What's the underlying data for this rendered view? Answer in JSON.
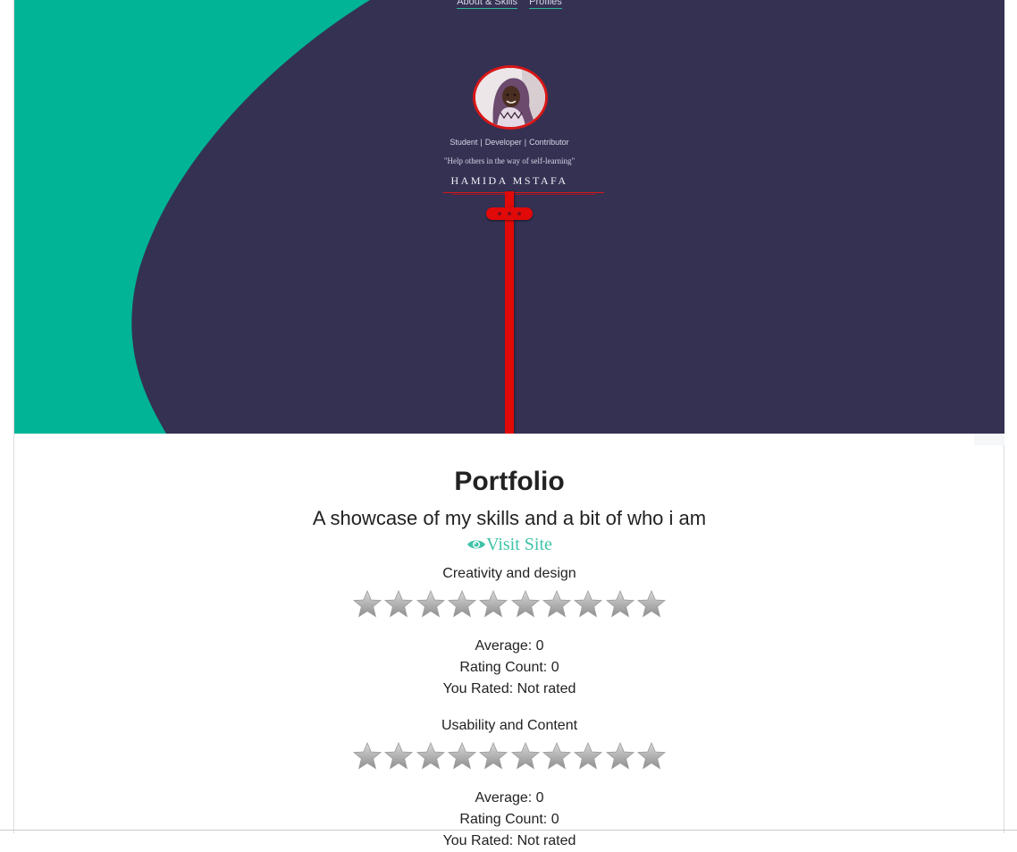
{
  "nav": {
    "links": [
      "About & Skills",
      "Profiles"
    ]
  },
  "profile": {
    "roles": [
      "Student",
      "Developer",
      "Contributor"
    ],
    "quote": "\"Help others in the way of self-learning\"",
    "name": "HAMIDA MSTAFA"
  },
  "colors": {
    "hero_bg": "#343153",
    "hero_accent": "#00b495",
    "pole_red": "#e20909",
    "link_teal": "#3fc3a8"
  },
  "portfolio": {
    "title": "Portfolio",
    "subtitle": "A showcase of my skills and a bit of who i am",
    "visit_label": "Visit Site",
    "visit_icon": "eye-icon"
  },
  "ratings": [
    {
      "label": "Creativity and design",
      "stars_total": 10,
      "stars_filled": 0,
      "average": "Average: 0",
      "count": "Rating Count: 0",
      "you_rated": "You Rated: Not rated"
    },
    {
      "label": "Usability and Content",
      "stars_total": 10,
      "stars_filled": 0,
      "average": "Average: 0",
      "count": "Rating Count: 0",
      "you_rated": "You Rated: Not rated"
    }
  ]
}
